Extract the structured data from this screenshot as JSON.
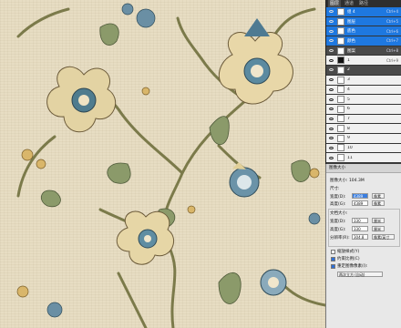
{
  "layers_panel": {
    "tabs": [
      "图层",
      "通道",
      "路径"
    ],
    "layers": [
      {
        "name": "组 4",
        "opacity": "Ctrl+4",
        "state": "selected",
        "thumb": "white"
      },
      {
        "name": "图层",
        "opacity": "Ctrl+5",
        "state": "selected",
        "thumb": "white"
      },
      {
        "name": "底色",
        "opacity": "Ctrl+6",
        "state": "selected",
        "thumb": "white"
      },
      {
        "name": "颜色",
        "opacity": "Ctrl+7",
        "state": "selected",
        "thumb": "white"
      },
      {
        "name": "图案",
        "opacity": "Ctrl+8",
        "state": "dark",
        "thumb": "white"
      },
      {
        "name": "1",
        "opacity": "Ctrl+9",
        "state": "normal",
        "thumb": "black"
      },
      {
        "name": "2",
        "opacity": "",
        "state": "dark",
        "thumb": "white"
      },
      {
        "name": "3",
        "opacity": "",
        "state": "normal",
        "thumb": "white"
      },
      {
        "name": "4",
        "opacity": "",
        "state": "normal",
        "thumb": "white"
      },
      {
        "name": "5",
        "opacity": "",
        "state": "normal",
        "thumb": "white"
      },
      {
        "name": "6",
        "opacity": "",
        "state": "normal",
        "thumb": "white"
      },
      {
        "name": "7",
        "opacity": "",
        "state": "normal",
        "thumb": "white"
      },
      {
        "name": "8",
        "opacity": "",
        "state": "normal",
        "thumb": "white"
      },
      {
        "name": "9",
        "opacity": "",
        "state": "normal",
        "thumb": "white"
      },
      {
        "name": "10",
        "opacity": "",
        "state": "normal",
        "thumb": "white"
      },
      {
        "name": "11",
        "opacity": "",
        "state": "normal",
        "thumb": "white"
      }
    ]
  },
  "image_size_dialog": {
    "title": "图像大小",
    "image_size": "图像大小: 104.3M",
    "dimensions_label": "尺寸:",
    "width_label": "宽度(D):",
    "width_value": "4389",
    "width_unit": "像素",
    "height_label": "高度(G):",
    "height_value": "4389",
    "height_unit": "像素",
    "doc_size_label": "文档大小:",
    "doc_width_label": "宽度(D):",
    "doc_width_value": "330",
    "doc_width_unit": "厘米",
    "doc_height_label": "高度(G):",
    "doc_height_value": "330",
    "doc_height_unit": "厘米",
    "resolution_label": "分辨率(R):",
    "resolution_value": "304.8",
    "resolution_unit": "像素/英寸",
    "scale_styles": "缩放样式(Y)",
    "constrain": "约束比例(C)",
    "resample": "重定图像像素(I):",
    "resample_method": "两次立方 (自动)"
  }
}
